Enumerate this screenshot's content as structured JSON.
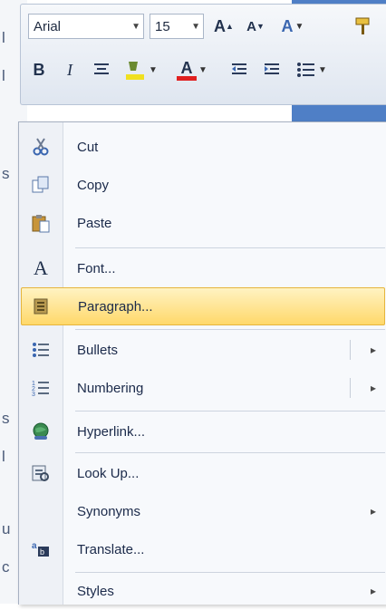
{
  "document": {
    "fragments": [
      "l",
      "l",
      "s",
      "s",
      "l",
      "u",
      "c"
    ]
  },
  "mini_toolbar": {
    "font_name": "Arial",
    "font_size": "15",
    "grow_font_label": "A",
    "shrink_font_label": "A",
    "styles_label": "A",
    "bold_label": "B",
    "italic_label": "I",
    "font_color_label": "A"
  },
  "context_menu": {
    "items": [
      {
        "label": "Cut",
        "icon": "scissors-icon"
      },
      {
        "label": "Copy",
        "icon": "copy-icon"
      },
      {
        "label": "Paste",
        "icon": "paste-icon"
      },
      {
        "label": "Font...",
        "icon": "font-icon"
      },
      {
        "label": "Paragraph...",
        "icon": "paragraph-icon"
      },
      {
        "label": "Bullets",
        "icon": "bullets-icon"
      },
      {
        "label": "Numbering",
        "icon": "numbering-icon"
      },
      {
        "label": "Hyperlink...",
        "icon": "hyperlink-icon"
      },
      {
        "label": "Look Up...",
        "icon": "lookup-icon"
      },
      {
        "label": "Synonyms",
        "icon": ""
      },
      {
        "label": "Translate...",
        "icon": "translate-icon"
      },
      {
        "label": "Styles",
        "icon": ""
      }
    ],
    "highlighted": "Paragraph...",
    "submenu_arrow": "▸"
  },
  "colors": {
    "highlight": "#ffd86a",
    "font_color_bar": "#e02020",
    "highlight_color_bar": "#f0e020"
  }
}
